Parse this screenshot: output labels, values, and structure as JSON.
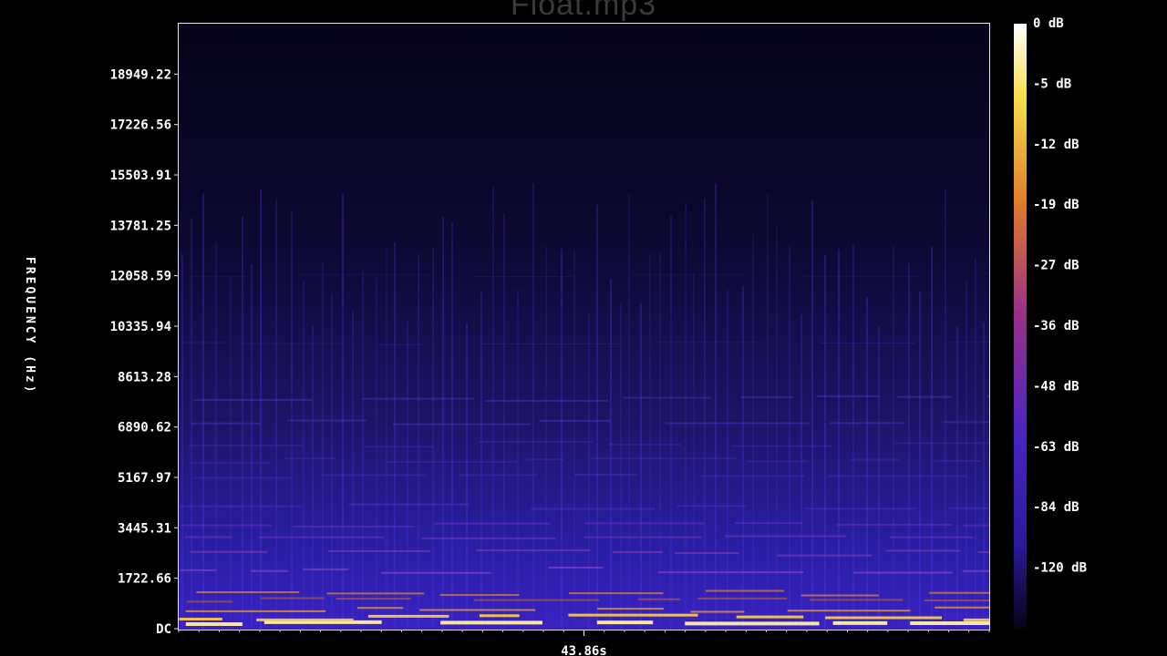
{
  "window": {
    "title": "Float.mp3"
  },
  "chart_data": {
    "type": "heatmap",
    "title": "Float.mp3",
    "ylabel": "FREQUENCY (Hz)",
    "xlabel": "",
    "y_ticks": [
      "DC",
      "1722.66",
      "3445.31",
      "5167.97",
      "6890.62",
      "8613.28",
      "10335.94",
      "12058.59",
      "13781.25",
      "15503.91",
      "17226.56",
      "18949.22"
    ],
    "y_tick_values": [
      0,
      1722.66,
      3445.31,
      5167.97,
      6890.62,
      8613.28,
      10335.94,
      12058.59,
      13781.25,
      15503.91,
      17226.56,
      18949.22
    ],
    "ylim": [
      0,
      20671.88
    ],
    "x_ticks": [
      "43.86s"
    ],
    "x_tick_values": [
      43.86
    ],
    "xlim": [
      0,
      87.72
    ],
    "colorbar": {
      "labels": [
        "0 dB",
        "-5 dB",
        "-12 dB",
        "-19 dB",
        "-27 dB",
        "-36 dB",
        "-48 dB",
        "-63 dB",
        "-84 dB",
        "-120 dB"
      ],
      "colors": [
        "#fffef0",
        "#f7e04a",
        "#f2a52e",
        "#e0792a",
        "#b0406a",
        "#7a2a9a",
        "#4a23c4",
        "#2a1a9a",
        "#130d4a",
        "#060418"
      ]
    },
    "grid": false,
    "legend": "right"
  }
}
